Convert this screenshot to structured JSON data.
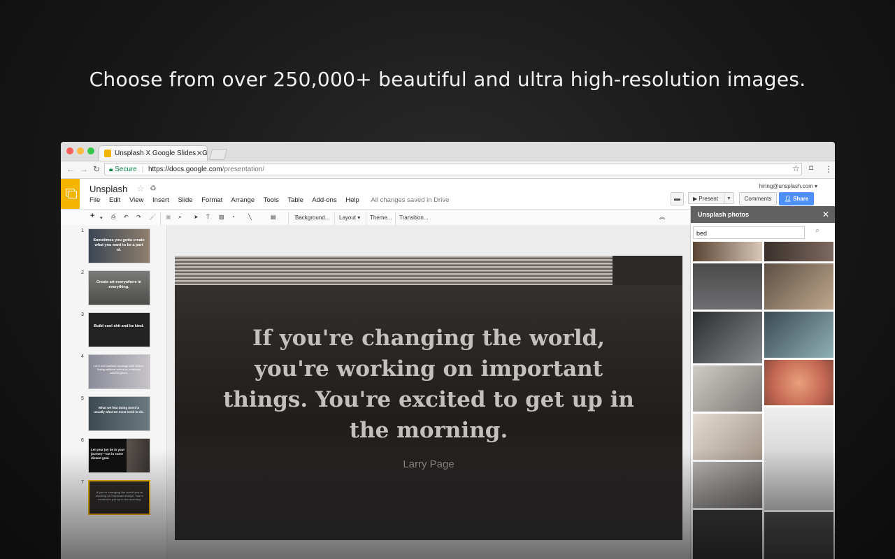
{
  "headline": "Choose from over 250,000+ beautiful and ultra high-resolution images.",
  "browser": {
    "tab_title": "Unsplash X Google Slides - Go",
    "secure_label": "Secure",
    "url_scheme_host": "https://docs.google.com",
    "url_path": "/presentation/"
  },
  "app": {
    "title": "Unsplash",
    "menu": [
      "File",
      "Edit",
      "View",
      "Insert",
      "Slide",
      "Format",
      "Arrange",
      "Tools",
      "Table",
      "Add-ons",
      "Help"
    ],
    "save_status": "All changes saved in Drive",
    "account": "hiring@unsplash.com",
    "present_label": "Present",
    "comments_label": "Comments",
    "share_label": "Share"
  },
  "toolbar": {
    "background": "Background...",
    "layout": "Layout",
    "theme": "Theme...",
    "transition": "Transition..."
  },
  "slides": [
    {
      "num": "1",
      "caption": "Sometimes you gotta create what you want to be a part of."
    },
    {
      "num": "2",
      "caption": "Create art everywhere in everything."
    },
    {
      "num": "3",
      "caption": "Build cool shit and be kind."
    },
    {
      "num": "4",
      "caption": "Let's not confuse courage with action. Doing without action is relatively meaningless."
    },
    {
      "num": "5",
      "caption": "What we fear doing most is usually what we most need to do."
    },
    {
      "num": "6",
      "caption": "Let your joy be in your journey—not in some distant goal."
    },
    {
      "num": "7",
      "caption": "If you're changing the world you're working on important things. You're excited to get up in the morning."
    }
  ],
  "current_slide": {
    "quote": "If you're changing the world, you're working on important things. You're excited to get up in the morning.",
    "author": "Larry Page"
  },
  "panel": {
    "title": "Unsplash photos",
    "search_value": "bed"
  },
  "colors": {
    "slides_brand": "#f4b400",
    "share_blue": "#4d90fe",
    "panel_header": "#616161"
  }
}
